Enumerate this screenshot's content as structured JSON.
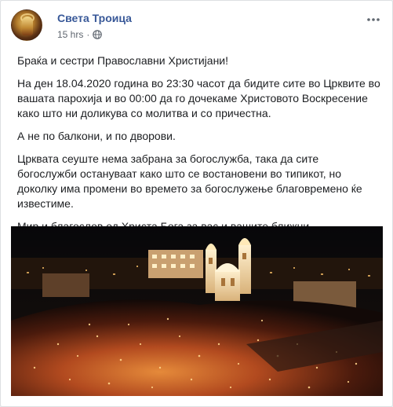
{
  "post": {
    "author": "Света Троица",
    "timestamp": "15 hrs",
    "separator": "·",
    "paragraphs": [
      "Браќа и сестри Православни Христијани!",
      "На ден 18.04.2020 година во 23:30 часот да бидите сите во Црквите во вашата парохија и во 00:00 да го дочекаме Христовото Воскресение како што ни доликува со молитва и со причестна.",
      "А не по балкони, и по дворови.",
      "Црквата сеуште нема забрана за богослужба, така да сите богослужби остануваат како што се востановени во типикот, но доколку има промени во времето за богослужење благовремено ќе известиме.",
      "Мир и благослов од Христа Бога за вас и вашите ближни."
    ]
  },
  "icons": {
    "audience": "globe-icon",
    "menu": "more-horizontal-icon",
    "avatar": "page-avatar-icon"
  },
  "colors": {
    "name": "#385898",
    "text": "#1c1e21",
    "meta": "#606770",
    "border": "#dddfe2"
  }
}
